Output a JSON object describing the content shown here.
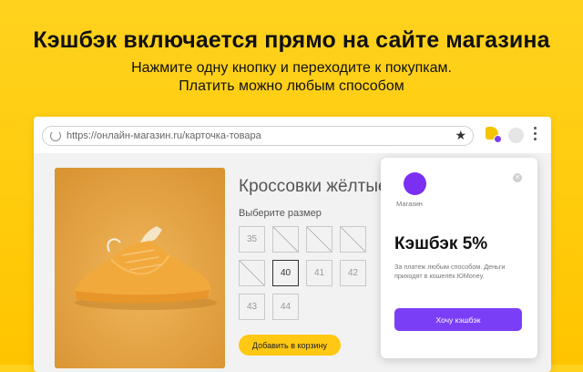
{
  "promo": {
    "headline": "Кэшбэк включается прямо на сайте магазина",
    "subline1": "Нажмите одну кнопку и переходите к покупкам.",
    "subline2": "Платить можно любым способом"
  },
  "browser": {
    "url": "https://онлайн-магазин.ru/карточка-товара"
  },
  "product": {
    "title": "Кроссовки жёлтые",
    "size_label": "Выберите размер",
    "sizes": [
      {
        "label": "35",
        "state": "available"
      },
      {
        "label": "",
        "state": "unavailable"
      },
      {
        "label": "",
        "state": "unavailable"
      },
      {
        "label": "",
        "state": "unavailable"
      },
      {
        "label": "",
        "state": "unavailable"
      },
      {
        "label": "40",
        "state": "selected"
      },
      {
        "label": "41",
        "state": "available"
      },
      {
        "label": "42",
        "state": "available"
      },
      {
        "label": "43",
        "state": "available"
      },
      {
        "label": "44",
        "state": "available"
      }
    ],
    "add_to_cart": "Добавить в корзину"
  },
  "popup": {
    "store_label": "Магазин",
    "cashback_title": "Кэшбэк 5%",
    "description": "За платеж любым способом. Деньги приходят в кошелёк ЮMoney.",
    "button_label": "Хочу кэшбэк"
  },
  "colors": {
    "background": "#ffcc0d",
    "accent_purple": "#7a3ef6",
    "cart_button": "#ffc813",
    "shoe": "#e8a544"
  }
}
